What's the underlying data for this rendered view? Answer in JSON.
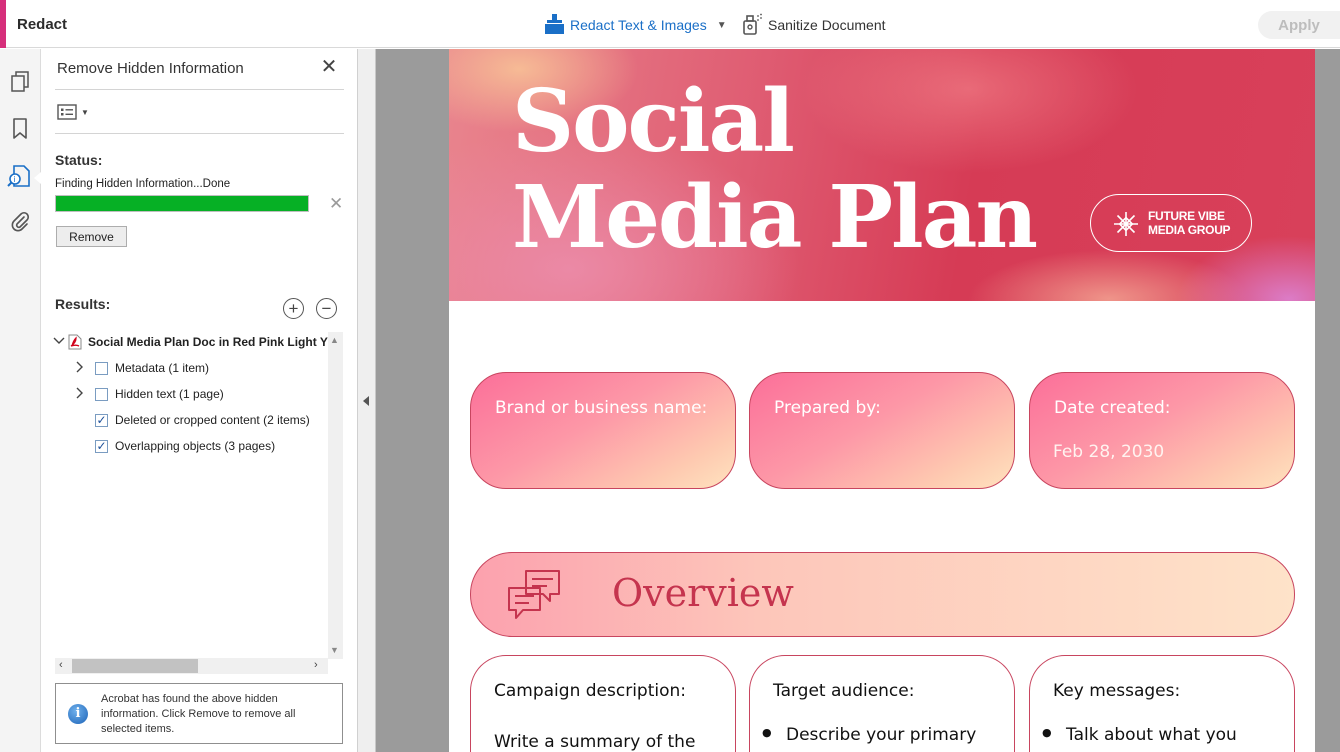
{
  "app": {
    "title": "Redact"
  },
  "toolbar": {
    "redact_label": "Redact Text & Images",
    "sanitize_label": "Sanitize Document",
    "apply_label": "Apply"
  },
  "panel": {
    "title": "Remove Hidden Information",
    "status_label": "Status:",
    "status_text": "Finding Hidden Information...Done",
    "progress": 1.0,
    "remove_label": "Remove",
    "results_label": "Results:",
    "tree": {
      "root": "Social Media Plan Doc in Red Pink Light Y",
      "items": [
        {
          "label": "Metadata (1 item)",
          "checked": false,
          "expandable": true
        },
        {
          "label": "Hidden text (1 page)",
          "checked": false,
          "expandable": true
        },
        {
          "label": "Deleted or cropped content (2 items)",
          "checked": true,
          "expandable": false
        },
        {
          "label": "Overlapping objects (3 pages)",
          "checked": true,
          "expandable": false
        }
      ]
    },
    "info_text": "Acrobat has found the above hidden information. Click Remove to remove all selected items."
  },
  "document": {
    "title_line1": "Social",
    "title_line2": "Media Plan",
    "brand_line1": "FUTURE VIBE",
    "brand_line2": "MEDIA GROUP",
    "fields": {
      "brand_label": "Brand or business name:",
      "prepared_label": "Prepared by:",
      "date_label": "Date created:",
      "date_value": "Feb 28, 2030"
    },
    "overview_title": "Overview",
    "cards": {
      "campaign_title": "Campaign description:",
      "campaign_text": "Write a summary of the",
      "audience_title": "Target audience:",
      "audience_text": "Describe your primary",
      "messages_title": "Key messages:",
      "messages_text": "Talk about what you"
    }
  },
  "colors": {
    "accent": "#d62f7b",
    "link_blue": "#1a6fc7",
    "progress_green": "#06b025",
    "brand_red": "#c5344e"
  }
}
